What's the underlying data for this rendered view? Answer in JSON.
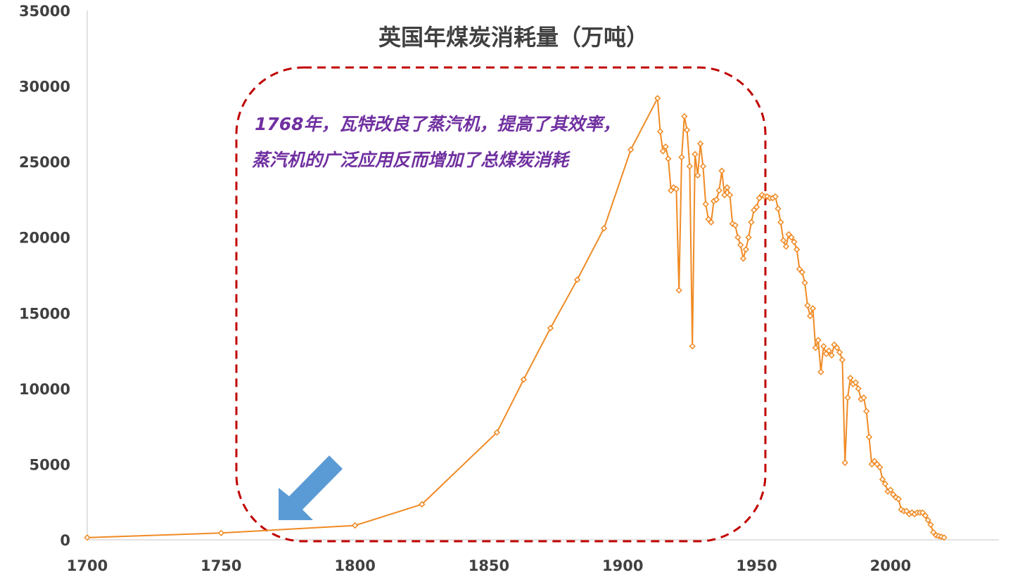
{
  "chart_data": {
    "type": "line",
    "title": "英国年煤炭消耗量（万吨）",
    "xlabel": "",
    "ylabel": "",
    "xlim": [
      1700,
      2020
    ],
    "ylim": [
      0,
      35000
    ],
    "x_ticks": [
      1700,
      1750,
      1800,
      1850,
      1900,
      1950,
      2000
    ],
    "y_ticks": [
      0,
      5000,
      10000,
      15000,
      20000,
      25000,
      30000,
      35000
    ],
    "grid": false,
    "legend": "none",
    "series": [
      {
        "color": "#f08a24",
        "points": [
          [
            1700,
            150
          ],
          [
            1750,
            450
          ],
          [
            1800,
            950
          ],
          [
            1825,
            2350
          ],
          [
            1853,
            7100
          ],
          [
            1863,
            10600
          ],
          [
            1873,
            14000
          ],
          [
            1883,
            17200
          ],
          [
            1893,
            20600
          ],
          [
            1903,
            25800
          ],
          [
            1913,
            29200
          ],
          [
            1914,
            27000
          ],
          [
            1915,
            25700
          ],
          [
            1916,
            26000
          ],
          [
            1917,
            25200
          ],
          [
            1918,
            23100
          ],
          [
            1919,
            23300
          ],
          [
            1920,
            23200
          ],
          [
            1921,
            16500
          ],
          [
            1922,
            25300
          ],
          [
            1923,
            28000
          ],
          [
            1924,
            27100
          ],
          [
            1925,
            24700
          ],
          [
            1926,
            12800
          ],
          [
            1927,
            25500
          ],
          [
            1928,
            24100
          ],
          [
            1929,
            26200
          ],
          [
            1930,
            24700
          ],
          [
            1931,
            22200
          ],
          [
            1932,
            21200
          ],
          [
            1933,
            21000
          ],
          [
            1934,
            22400
          ],
          [
            1935,
            22500
          ],
          [
            1936,
            23100
          ],
          [
            1937,
            24400
          ],
          [
            1938,
            22800
          ],
          [
            1939,
            23300
          ],
          [
            1940,
            22800
          ],
          [
            1941,
            20900
          ],
          [
            1942,
            20800
          ],
          [
            1943,
            20000
          ],
          [
            1944,
            19500
          ],
          [
            1945,
            18600
          ],
          [
            1946,
            19200
          ],
          [
            1947,
            20000
          ],
          [
            1948,
            21000
          ],
          [
            1949,
            21800
          ],
          [
            1950,
            22000
          ],
          [
            1951,
            22600
          ],
          [
            1952,
            22800
          ],
          [
            1953,
            22700
          ],
          [
            1954,
            22700
          ],
          [
            1955,
            22600
          ],
          [
            1956,
            22600
          ],
          [
            1957,
            22700
          ],
          [
            1958,
            21900
          ],
          [
            1959,
            21000
          ],
          [
            1960,
            19800
          ],
          [
            1961,
            19400
          ],
          [
            1962,
            20200
          ],
          [
            1963,
            20000
          ],
          [
            1964,
            19700
          ],
          [
            1965,
            19200
          ],
          [
            1966,
            17900
          ],
          [
            1967,
            17700
          ],
          [
            1968,
            17000
          ],
          [
            1969,
            15500
          ],
          [
            1970,
            14800
          ],
          [
            1971,
            15300
          ],
          [
            1972,
            12700
          ],
          [
            1973,
            13200
          ],
          [
            1974,
            11100
          ],
          [
            1975,
            12800
          ],
          [
            1976,
            12300
          ],
          [
            1977,
            12500
          ],
          [
            1978,
            12200
          ],
          [
            1979,
            12900
          ],
          [
            1980,
            12700
          ],
          [
            1981,
            12400
          ],
          [
            1982,
            11900
          ],
          [
            1983,
            5100
          ],
          [
            1984,
            9400
          ],
          [
            1985,
            10700
          ],
          [
            1986,
            10300
          ],
          [
            1987,
            10400
          ],
          [
            1988,
            10000
          ],
          [
            1989,
            9300
          ],
          [
            1990,
            9400
          ],
          [
            1991,
            8500
          ],
          [
            1992,
            6800
          ],
          [
            1993,
            5000
          ],
          [
            1994,
            5200
          ],
          [
            1995,
            5000
          ],
          [
            1996,
            4800
          ],
          [
            1997,
            4000
          ],
          [
            1998,
            3700
          ],
          [
            1999,
            3200
          ],
          [
            2000,
            3300
          ],
          [
            2001,
            3000
          ],
          [
            2002,
            2800
          ],
          [
            2003,
            2700
          ],
          [
            2004,
            2000
          ],
          [
            2005,
            1900
          ],
          [
            2006,
            1900
          ],
          [
            2007,
            1700
          ],
          [
            2008,
            1800
          ],
          [
            2009,
            1700
          ],
          [
            2010,
            1800
          ],
          [
            2011,
            1800
          ],
          [
            2012,
            1800
          ],
          [
            2013,
            1600
          ],
          [
            2014,
            1300
          ],
          [
            2015,
            1000
          ],
          [
            2016,
            500
          ],
          [
            2017,
            300
          ],
          [
            2018,
            250
          ],
          [
            2019,
            200
          ],
          [
            2020,
            150
          ]
        ]
      }
    ],
    "annotations": [
      "1768年，瓦特改良了蒸汽机，提高了其效率，",
      "蒸汽机的广泛应用反而增加了总煤炭消耗"
    ],
    "annotation_color": "#7030a0",
    "highlight_box_color": "#c00000",
    "arrow_color": "#5b9bd5"
  }
}
